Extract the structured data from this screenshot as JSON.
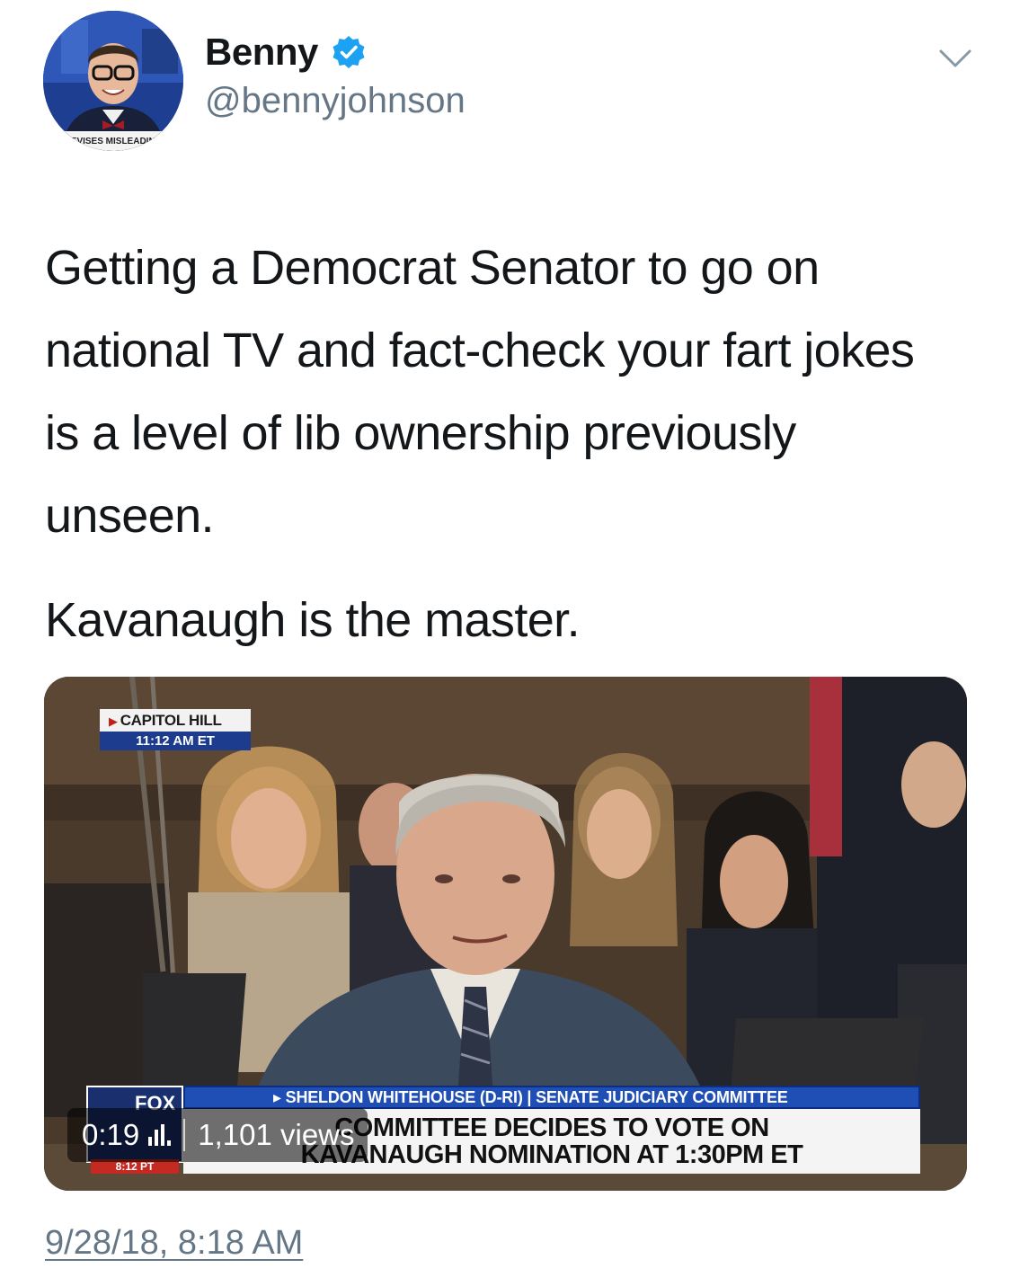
{
  "user": {
    "display_name": "Benny",
    "handle": "@bennyjohnson",
    "verified_icon": "verified-badge-icon",
    "verified_color": "#1da1f2",
    "avatar_chyron_text": "DEVISES MISLEADING"
  },
  "tweet": {
    "paragraphs": [
      "Getting a Democrat Senator to go on national TV and fact-check your fart jokes is a level of lib ownership previously unseen.",
      "Kavanaugh is the master."
    ],
    "timestamp": "9/28/18, 8:18 AM"
  },
  "media": {
    "type": "video",
    "location_label": "CAPITOL HILL",
    "location_time": "11:12 AM ET",
    "lower_third_top": "SHELDON WHITEHOUSE (D-RI) | SENATE JUDICIARY COMMITTEE",
    "headline_line1": "COMMITTEE DECIDES TO VOTE ON",
    "headline_line2": "KAVANAUGH NOMINATION AT 1:30PM ET",
    "network_logo": "FOX",
    "network_clock": "8:12 PT",
    "duration": "0:19",
    "views": "1,101 views",
    "views_icon": "bars-icon"
  },
  "icons": {
    "caret": "chevron-down-icon"
  },
  "colors": {
    "text": "#14171a",
    "secondary": "#657786",
    "fox_blue": "#1f4fb4"
  }
}
